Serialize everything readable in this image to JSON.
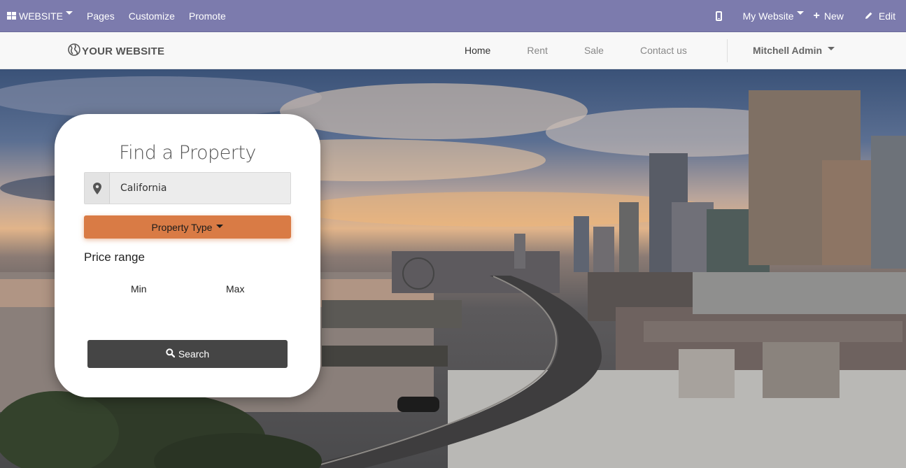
{
  "admin_bar": {
    "apps_label": "WEBSITE",
    "menu_items": [
      "Pages",
      "Customize",
      "Promote"
    ],
    "mobile_preview_icon": "mobile-icon",
    "website_switcher": "My Website",
    "new_label": "New",
    "edit_label": "Edit",
    "bg_color": "#7c7bad"
  },
  "navbar": {
    "brand": "YOUR WEBSITE",
    "links": [
      {
        "label": "Home",
        "active": true
      },
      {
        "label": "Rent",
        "active": false
      },
      {
        "label": "Sale",
        "active": false
      },
      {
        "label": "Contact us",
        "active": false
      }
    ],
    "user": "Mitchell Admin"
  },
  "search_card": {
    "title": "Find a Property",
    "location_value": "California",
    "location_icon": "map-marker-icon",
    "property_type_label": "Property Type",
    "property_type_color": "#d97b45",
    "price_range_label": "Price range",
    "min_label": "Min",
    "max_label": "Max",
    "search_label": "Search"
  }
}
